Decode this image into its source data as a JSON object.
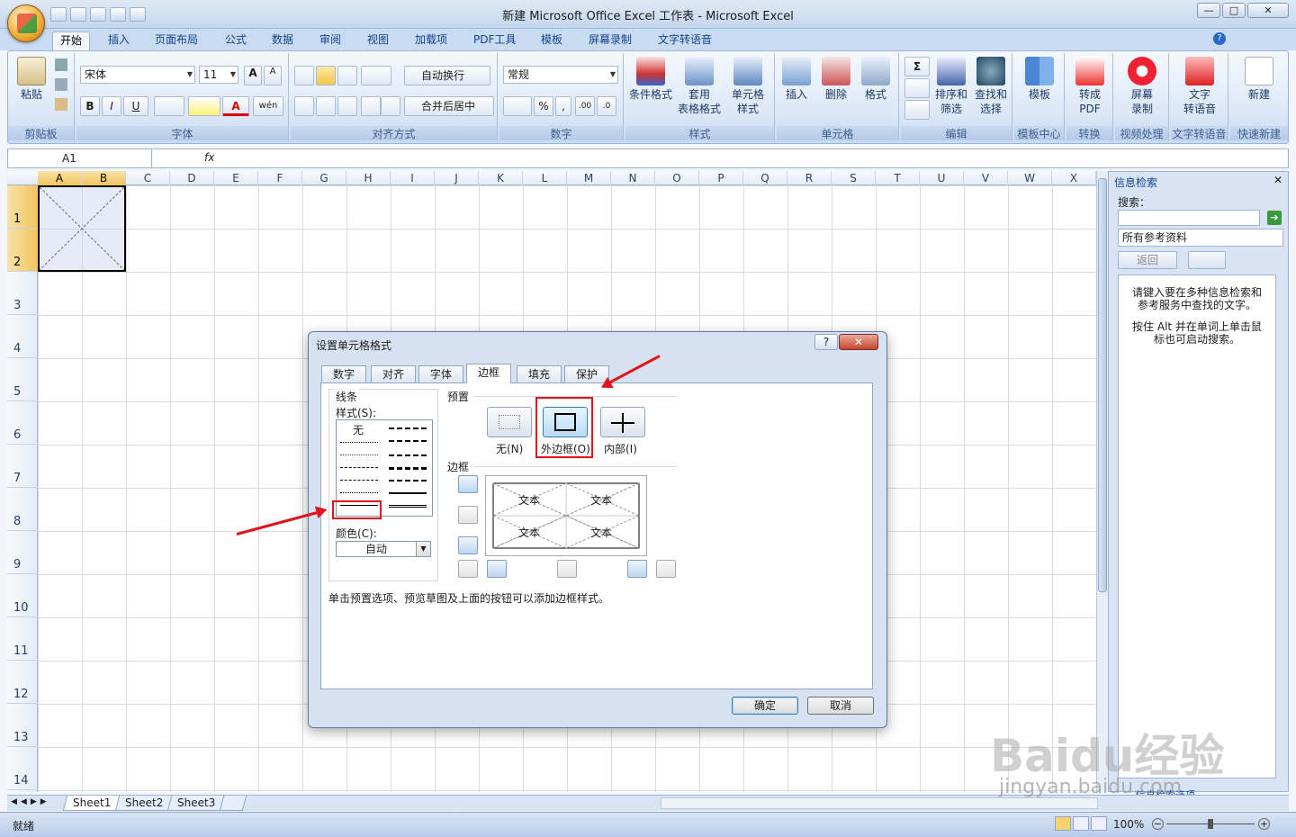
{
  "window": {
    "title": "新建 Microsoft Office Excel 工作表 - Microsoft Excel",
    "min": "—",
    "max": "□",
    "close": "✕"
  },
  "ribbon_tabs": [
    "开始",
    "插入",
    "页面布局",
    "公式",
    "数据",
    "审阅",
    "视图",
    "加载项",
    "PDF工具",
    "模板",
    "屏幕录制",
    "文字转语音"
  ],
  "ribbon": {
    "clipboard": {
      "paste": "粘贴",
      "label": "剪贴板"
    },
    "font": {
      "name": "宋体",
      "size": "11",
      "bold": "B",
      "italic": "I",
      "underline": "U",
      "label": "字体",
      "grow": "A",
      "shrink": "A",
      "color_letter": "A",
      "phonetic": "wén"
    },
    "alignment": {
      "wrap": "自动换行",
      "merge": "合并后居中",
      "label": "对齐方式"
    },
    "number": {
      "format": "常规",
      "percent": "%",
      "comma": ",",
      "inc": ".00",
      "dec": ".0",
      "label": "数字"
    },
    "styles": {
      "conditional": "条件格式",
      "table": "套用\n表格格式",
      "cell": "单元格\n样式",
      "label": "样式"
    },
    "cells": {
      "insert": "插入",
      "delete": "删除",
      "format": "格式",
      "label": "单元格"
    },
    "editing": {
      "sum": "Σ",
      "sort": "排序和\n筛选",
      "find": "查找和\n选择",
      "label": "编辑"
    },
    "template": {
      "btn": "模板",
      "label": "模板中心"
    },
    "convert": {
      "btn": "转成\nPDF",
      "label": "转换"
    },
    "record": {
      "btn": "屏幕\n录制",
      "label": "视频处理"
    },
    "tts": {
      "btn": "文字\n转语音",
      "label": "文字转语音"
    },
    "newbtn": {
      "btn": "新建",
      "label": "快速新建"
    }
  },
  "namebox": "A1",
  "fx": "fx",
  "columns": [
    "A",
    "B",
    "C",
    "D",
    "E",
    "F",
    "G",
    "H",
    "I",
    "J",
    "K",
    "L",
    "M",
    "N",
    "O",
    "P",
    "Q",
    "R",
    "S",
    "T",
    "U",
    "V",
    "W",
    "X"
  ],
  "rows": [
    "1",
    "2",
    "3",
    "4",
    "5",
    "6",
    "7",
    "8",
    "9",
    "10",
    "11",
    "12",
    "13",
    "14"
  ],
  "sheets": [
    "Sheet1",
    "Sheet2",
    "Sheet3"
  ],
  "status": {
    "ready": "就绪",
    "zoom": "100%"
  },
  "panel": {
    "title": "信息检索",
    "search_label": "搜索：",
    "source": "所有参考资料",
    "back": "返回",
    "hint1": "请键入要在多种信息检索和参考服务中查找的文字。",
    "hint2": "按住 Alt 并在单词上单击鼠标也可启动搜索。",
    "options": "信息检索选项"
  },
  "dialog": {
    "title": "设置单元格格式",
    "help": "?",
    "close": "✕",
    "tabs": [
      "数字",
      "对齐",
      "字体",
      "边框",
      "填充",
      "保护"
    ],
    "line_group": "线条",
    "style_label": "样式(S):",
    "none": "无",
    "color_label": "颜色(C):",
    "color_value": "自动",
    "preset_label": "预置",
    "presets": [
      "无(N)",
      "外边框(O)",
      "内部(I)"
    ],
    "border_label": "边框",
    "preview_text": [
      "文本",
      "文本",
      "文本",
      "文本"
    ],
    "hint": "单击预置选项、预览草图及上面的按钮可以添加边框样式。",
    "ok": "确定",
    "cancel": "取消"
  },
  "watermark": "Baidu经验",
  "watermark_url": "jingyan.baidu.com"
}
